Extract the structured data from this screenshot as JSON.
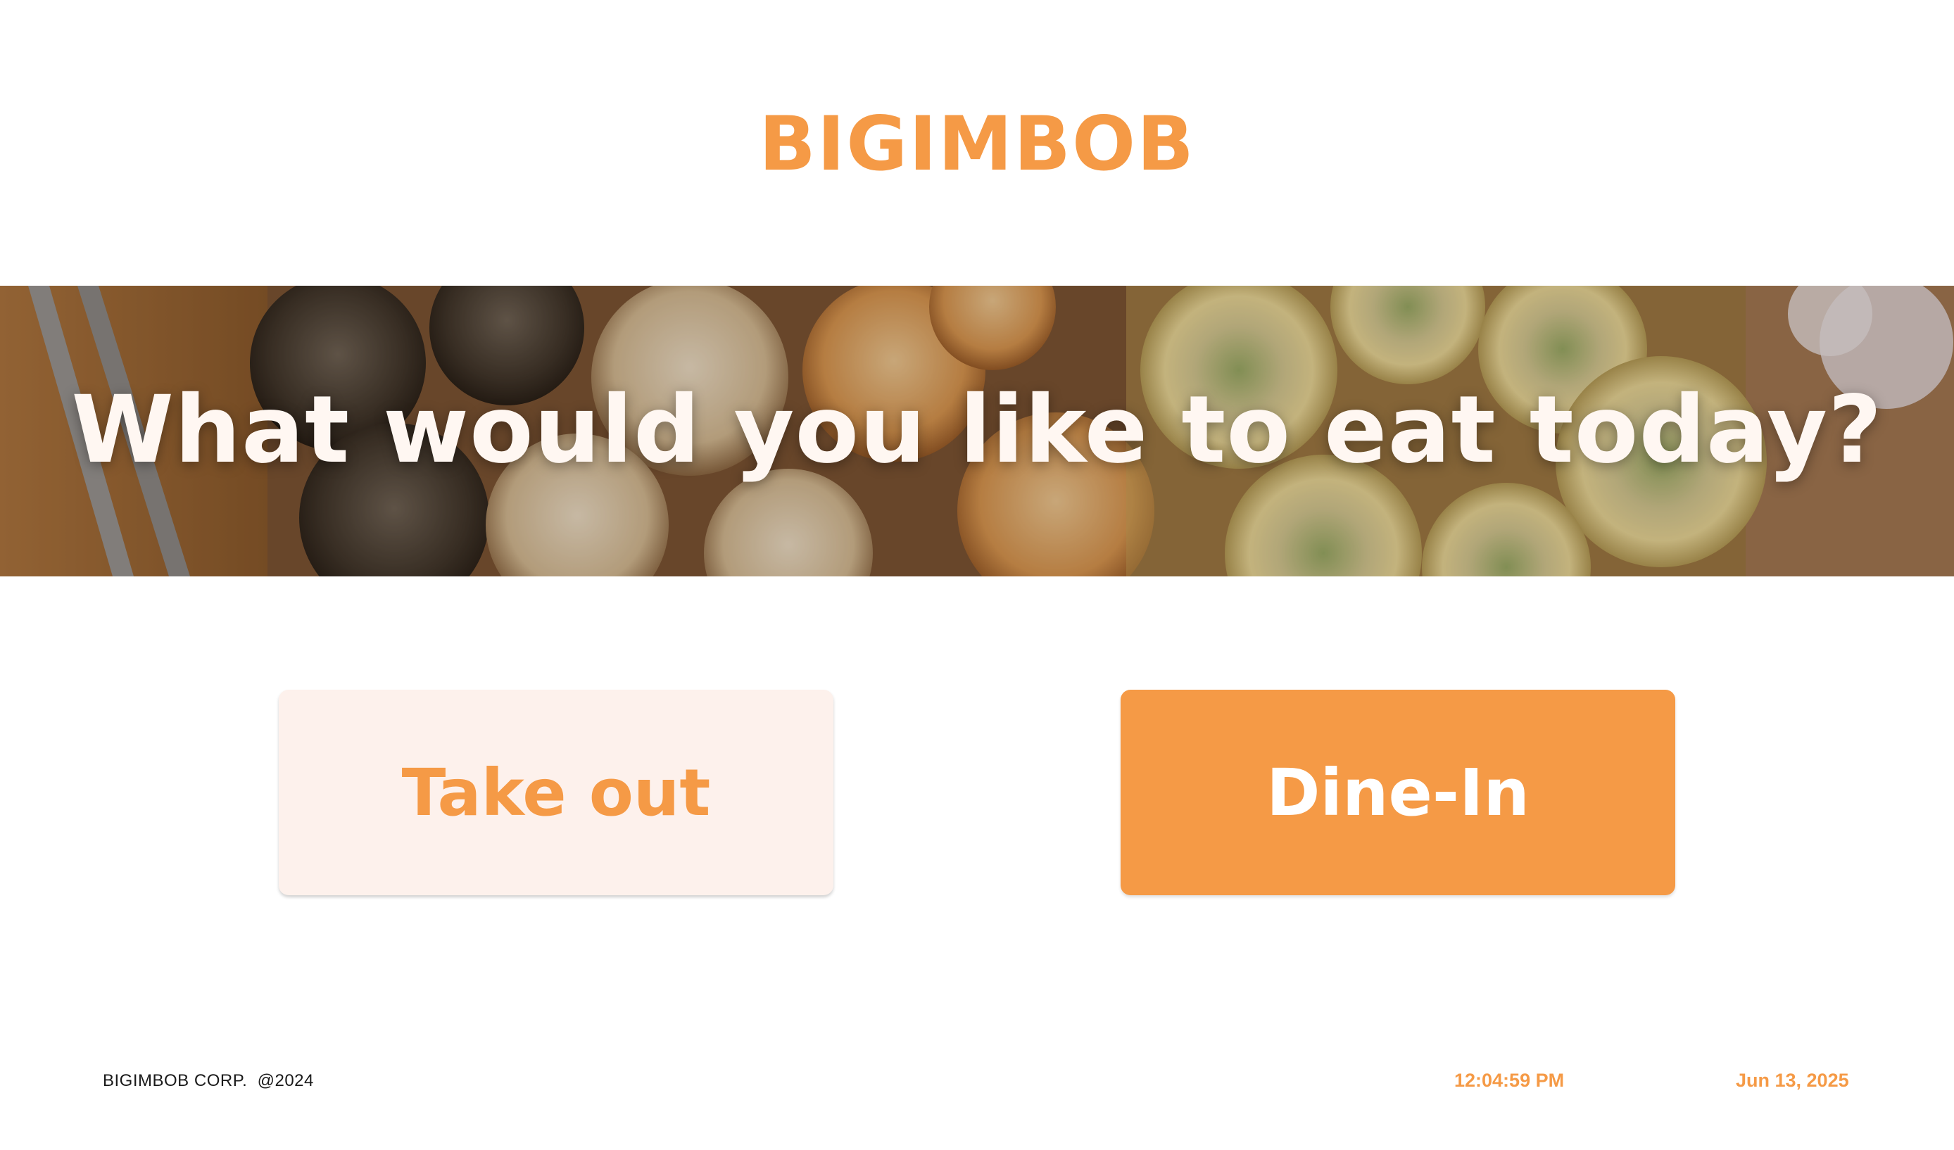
{
  "brand": {
    "logo_text": "BIGIMBOB",
    "accent_color": "#f59a46"
  },
  "hero": {
    "title": "What would you like to eat today?",
    "image": "food-banner-gimbap-riceballs"
  },
  "options": {
    "takeout_label": "Take out",
    "dinein_label": "Dine-In"
  },
  "footer": {
    "copyright": "BIGIMBOB CORP.  @2024",
    "time": "12:04:59 PM",
    "date": "Jun 13, 2025"
  }
}
